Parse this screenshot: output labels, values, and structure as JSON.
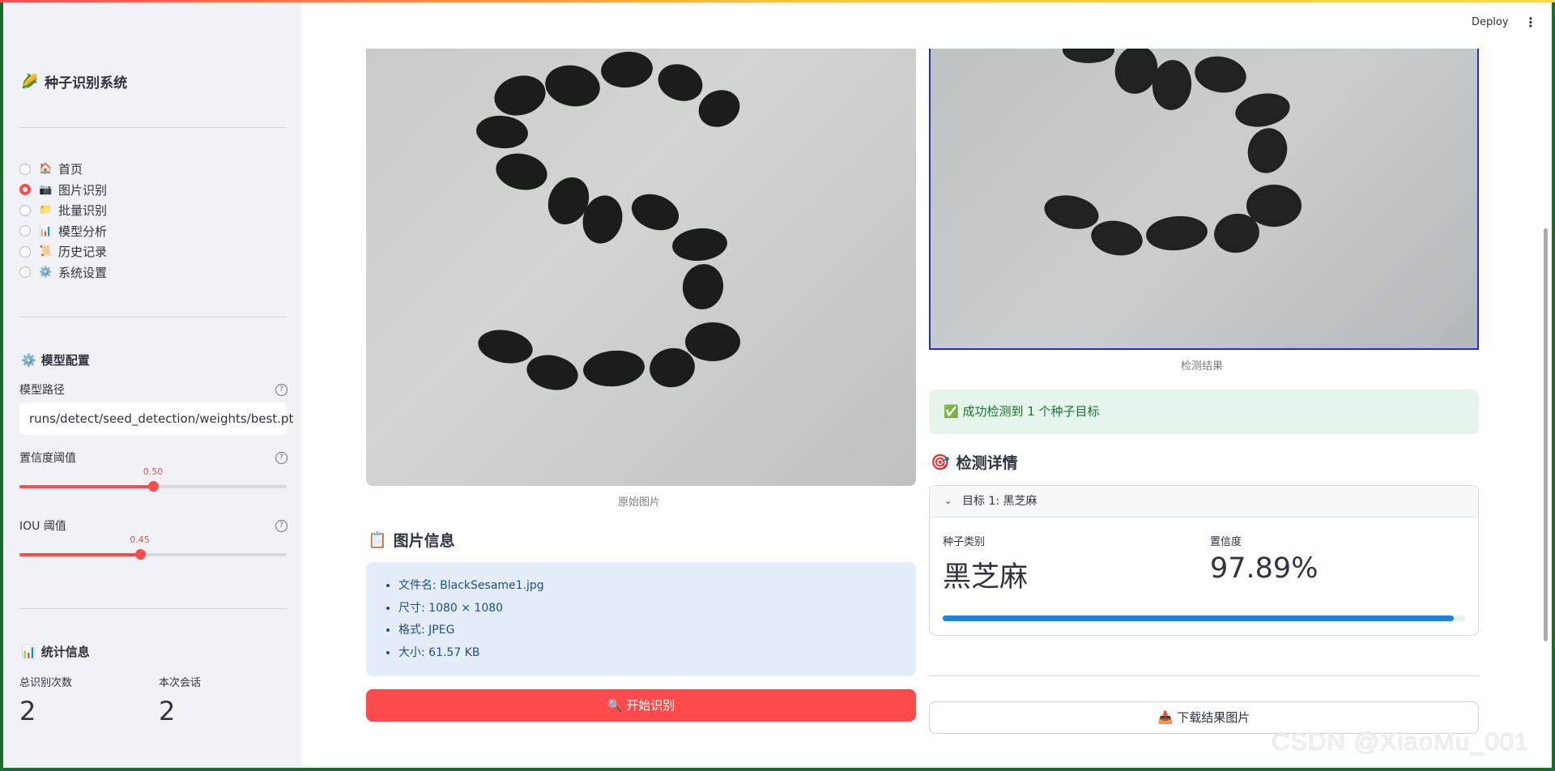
{
  "sidebar": {
    "title": "种子识别系统",
    "nav": [
      {
        "icon": "🏠",
        "label": "首页",
        "selected": false
      },
      {
        "icon": "📷",
        "label": "图片识别",
        "selected": true
      },
      {
        "icon": "📁",
        "label": "批量识别",
        "selected": false
      },
      {
        "icon": "📊",
        "label": "模型分析",
        "selected": false
      },
      {
        "icon": "📜",
        "label": "历史记录",
        "selected": false
      },
      {
        "icon": "⚙️",
        "label": "系统设置",
        "selected": false
      }
    ],
    "model_config": {
      "heading": "模型配置",
      "model_path_label": "模型路径",
      "model_path_value": "runs/detect/seed_detection/weights/best.pt",
      "conf_label": "置信度阈值",
      "conf_value": "0.50",
      "conf_fraction": 0.5,
      "iou_label": "IOU 阈值",
      "iou_value": "0.45",
      "iou_fraction": 0.45
    },
    "stats": {
      "heading": "统计信息",
      "total_label": "总识别次数",
      "total_value": "2",
      "session_label": "本次会话",
      "session_value": "2"
    }
  },
  "header": {
    "deploy_label": "Deploy",
    "menu_icon": "kebab-menu-icon"
  },
  "main": {
    "original_caption": "原始图片",
    "result_caption": "检测结果",
    "image_info": {
      "heading": "图片信息",
      "items": [
        "文件名: BlackSesame1.jpg",
        "尺寸: 1080 × 1080",
        "格式: JPEG",
        "大小: 61.57 KB"
      ]
    },
    "start_button": "开始识别",
    "success_message": "成功检测到 1 个种子目标",
    "details": {
      "heading": "检测详情",
      "target_title": "目标 1: 黑芝麻",
      "category_label": "种子类别",
      "category_value": "黑芝麻",
      "confidence_label": "置信度",
      "confidence_value": "97.89%",
      "confidence_fraction": 0.9789
    },
    "download_button": "下载结果图片"
  },
  "watermark": "CSDN @XiaoMu_001",
  "colors": {
    "accent": "#ff4b4b",
    "progress": "#1c83e1",
    "success_bg": "#e6f5ec",
    "info_bg": "#e5eef8"
  }
}
